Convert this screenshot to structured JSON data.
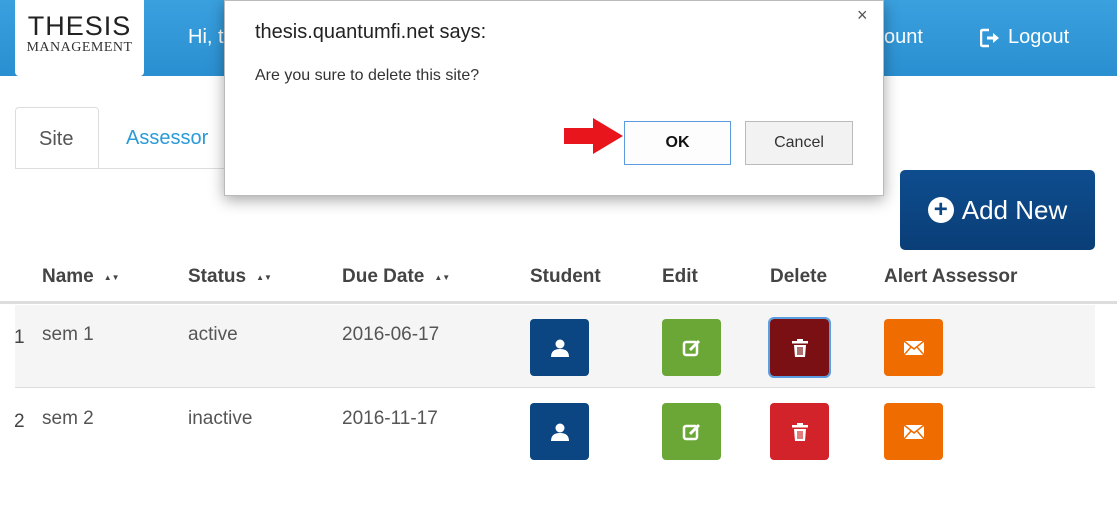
{
  "navbar": {
    "logo_line1": "THESIS",
    "logo_line2": "MANAGEMENT",
    "greeting": "Hi, t",
    "account_label": "count",
    "logout_label": "Logout",
    "logout_icon": "logout-icon"
  },
  "tabs": [
    {
      "label": "Site",
      "active": true
    },
    {
      "label": "Assessor",
      "active": false
    }
  ],
  "add_button": {
    "label": "Add New",
    "icon": "plus-circle-icon"
  },
  "table": {
    "columns": [
      "Name",
      "Status",
      "Due Date",
      "Student",
      "Edit",
      "Delete",
      "Alert Assessor"
    ],
    "rows": [
      {
        "num": "1",
        "name": "sem 1",
        "status": "active",
        "due": "2016-06-17"
      },
      {
        "num": "2",
        "name": "sem 2",
        "status": "inactive",
        "due": "2016-11-17"
      }
    ]
  },
  "dialog": {
    "title": "thesis.quantumfi.net says:",
    "message": "Are you sure to delete this site?",
    "ok_label": "OK",
    "cancel_label": "Cancel",
    "close_glyph": "×"
  },
  "colors": {
    "navbar": "#2a8fd0",
    "student_btn": "#0b4582",
    "edit_btn": "#6aa737",
    "delete_btn": "#d2232a",
    "delete_btn_focused": "#7a1014",
    "alert_btn": "#ef6c00",
    "arrow": "#e8161c"
  }
}
